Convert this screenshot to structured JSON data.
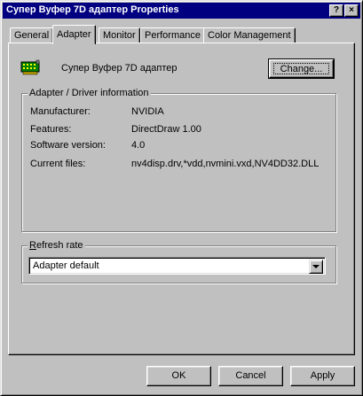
{
  "window": {
    "title": "Супер Вуфер 7D адаптер Properties",
    "help_glyph": "?",
    "close_glyph": "×"
  },
  "tabs": [
    {
      "label": "General"
    },
    {
      "label": "Adapter",
      "active": true
    },
    {
      "label": "Monitor"
    },
    {
      "label": "Performance"
    },
    {
      "label": "Color Management"
    }
  ],
  "adapter": {
    "icon": "display-adapter-icon",
    "name": "Супер Вуфер 7D адаптер",
    "change_button": "Change..."
  },
  "driver_info": {
    "legend": "Adapter / Driver information",
    "rows": [
      {
        "label": "Manufacturer:",
        "value": "NVIDIA"
      },
      {
        "label": "Features:",
        "value": "DirectDraw 1.00"
      },
      {
        "label": "Software version:",
        "value": "4.0"
      },
      {
        "label": "Current files:",
        "value": "nv4disp.drv,*vdd,nvmini.vxd,NV4DD32.DLL"
      }
    ]
  },
  "refresh_rate": {
    "legend_first": "R",
    "legend_rest": "efresh rate",
    "selected": "Adapter default"
  },
  "footer": {
    "ok": "OK",
    "cancel": "Cancel",
    "apply": "Apply"
  },
  "colors": {
    "titlebar": "#000080",
    "face": "#c0c0c0"
  }
}
